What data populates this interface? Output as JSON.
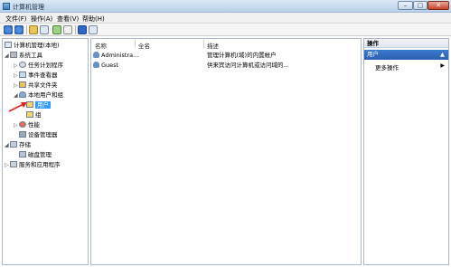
{
  "window": {
    "title": "计算机管理",
    "min": "–",
    "max": "▢",
    "close": "✕"
  },
  "menu": [
    "文件(F)",
    "操作(A)",
    "查看(V)",
    "帮助(H)"
  ],
  "toolbar": {
    "icons": [
      "back-icon",
      "forward-icon",
      "up-folder-icon",
      "show-hide-tree-icon",
      "refresh-icon",
      "export-icon",
      "help-icon",
      "properties-icon"
    ]
  },
  "tree": {
    "root": "计算机管理(本地)",
    "system_tools": "系统工具",
    "task_scheduler": "任务计划程序",
    "event_viewer": "事件查看器",
    "shared_folders": "共享文件夹",
    "local_users_groups": "本地用户和组",
    "users": "用户",
    "groups": "组",
    "performance": "性能",
    "device_manager": "设备管理器",
    "storage": "存储",
    "disk_management": "磁盘管理",
    "services_apps": "服务和应用程序"
  },
  "list": {
    "headers": {
      "name": "名称",
      "fullname": "全名",
      "description": "描述"
    },
    "rows": [
      {
        "name": "Administra...",
        "fullname": "",
        "description": "管理计算机(域)的内置帐户"
      },
      {
        "name": "Guest",
        "fullname": "",
        "description": "供来宾访问计算机或访问域的..."
      }
    ]
  },
  "actions": {
    "header": "操作",
    "group": "用户",
    "group_chevron": "▲",
    "more": "更多操作",
    "more_arrow": "▶"
  }
}
